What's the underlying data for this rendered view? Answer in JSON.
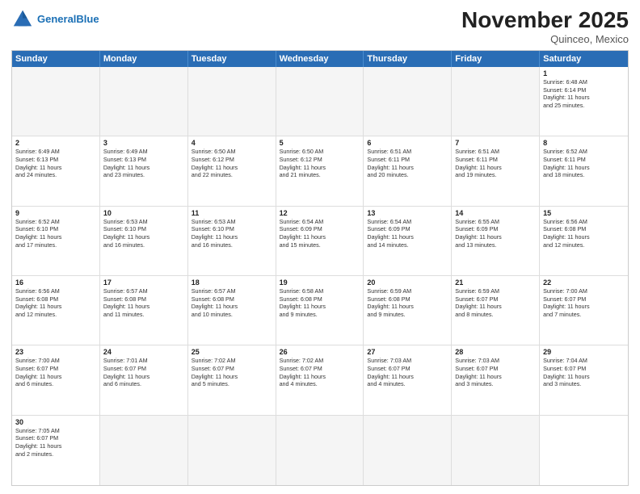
{
  "header": {
    "logo_general": "General",
    "logo_blue": "Blue",
    "month_title": "November 2025",
    "location": "Quinceo, Mexico"
  },
  "days": [
    "Sunday",
    "Monday",
    "Tuesday",
    "Wednesday",
    "Thursday",
    "Friday",
    "Saturday"
  ],
  "cells": [
    {
      "day": "",
      "info": ""
    },
    {
      "day": "",
      "info": ""
    },
    {
      "day": "",
      "info": ""
    },
    {
      "day": "",
      "info": ""
    },
    {
      "day": "",
      "info": ""
    },
    {
      "day": "",
      "info": ""
    },
    {
      "day": "1",
      "info": "Sunrise: 6:48 AM\nSunset: 6:14 PM\nDaylight: 11 hours\nand 25 minutes."
    },
    {
      "day": "2",
      "info": "Sunrise: 6:49 AM\nSunset: 6:13 PM\nDaylight: 11 hours\nand 24 minutes."
    },
    {
      "day": "3",
      "info": "Sunrise: 6:49 AM\nSunset: 6:13 PM\nDaylight: 11 hours\nand 23 minutes."
    },
    {
      "day": "4",
      "info": "Sunrise: 6:50 AM\nSunset: 6:12 PM\nDaylight: 11 hours\nand 22 minutes."
    },
    {
      "day": "5",
      "info": "Sunrise: 6:50 AM\nSunset: 6:12 PM\nDaylight: 11 hours\nand 21 minutes."
    },
    {
      "day": "6",
      "info": "Sunrise: 6:51 AM\nSunset: 6:11 PM\nDaylight: 11 hours\nand 20 minutes."
    },
    {
      "day": "7",
      "info": "Sunrise: 6:51 AM\nSunset: 6:11 PM\nDaylight: 11 hours\nand 19 minutes."
    },
    {
      "day": "8",
      "info": "Sunrise: 6:52 AM\nSunset: 6:11 PM\nDaylight: 11 hours\nand 18 minutes."
    },
    {
      "day": "9",
      "info": "Sunrise: 6:52 AM\nSunset: 6:10 PM\nDaylight: 11 hours\nand 17 minutes."
    },
    {
      "day": "10",
      "info": "Sunrise: 6:53 AM\nSunset: 6:10 PM\nDaylight: 11 hours\nand 16 minutes."
    },
    {
      "day": "11",
      "info": "Sunrise: 6:53 AM\nSunset: 6:10 PM\nDaylight: 11 hours\nand 16 minutes."
    },
    {
      "day": "12",
      "info": "Sunrise: 6:54 AM\nSunset: 6:09 PM\nDaylight: 11 hours\nand 15 minutes."
    },
    {
      "day": "13",
      "info": "Sunrise: 6:54 AM\nSunset: 6:09 PM\nDaylight: 11 hours\nand 14 minutes."
    },
    {
      "day": "14",
      "info": "Sunrise: 6:55 AM\nSunset: 6:09 PM\nDaylight: 11 hours\nand 13 minutes."
    },
    {
      "day": "15",
      "info": "Sunrise: 6:56 AM\nSunset: 6:08 PM\nDaylight: 11 hours\nand 12 minutes."
    },
    {
      "day": "16",
      "info": "Sunrise: 6:56 AM\nSunset: 6:08 PM\nDaylight: 11 hours\nand 12 minutes."
    },
    {
      "day": "17",
      "info": "Sunrise: 6:57 AM\nSunset: 6:08 PM\nDaylight: 11 hours\nand 11 minutes."
    },
    {
      "day": "18",
      "info": "Sunrise: 6:57 AM\nSunset: 6:08 PM\nDaylight: 11 hours\nand 10 minutes."
    },
    {
      "day": "19",
      "info": "Sunrise: 6:58 AM\nSunset: 6:08 PM\nDaylight: 11 hours\nand 9 minutes."
    },
    {
      "day": "20",
      "info": "Sunrise: 6:59 AM\nSunset: 6:08 PM\nDaylight: 11 hours\nand 9 minutes."
    },
    {
      "day": "21",
      "info": "Sunrise: 6:59 AM\nSunset: 6:07 PM\nDaylight: 11 hours\nand 8 minutes."
    },
    {
      "day": "22",
      "info": "Sunrise: 7:00 AM\nSunset: 6:07 PM\nDaylight: 11 hours\nand 7 minutes."
    },
    {
      "day": "23",
      "info": "Sunrise: 7:00 AM\nSunset: 6:07 PM\nDaylight: 11 hours\nand 6 minutes."
    },
    {
      "day": "24",
      "info": "Sunrise: 7:01 AM\nSunset: 6:07 PM\nDaylight: 11 hours\nand 6 minutes."
    },
    {
      "day": "25",
      "info": "Sunrise: 7:02 AM\nSunset: 6:07 PM\nDaylight: 11 hours\nand 5 minutes."
    },
    {
      "day": "26",
      "info": "Sunrise: 7:02 AM\nSunset: 6:07 PM\nDaylight: 11 hours\nand 4 minutes."
    },
    {
      "day": "27",
      "info": "Sunrise: 7:03 AM\nSunset: 6:07 PM\nDaylight: 11 hours\nand 4 minutes."
    },
    {
      "day": "28",
      "info": "Sunrise: 7:03 AM\nSunset: 6:07 PM\nDaylight: 11 hours\nand 3 minutes."
    },
    {
      "day": "29",
      "info": "Sunrise: 7:04 AM\nSunset: 6:07 PM\nDaylight: 11 hours\nand 3 minutes."
    },
    {
      "day": "30",
      "info": "Sunrise: 7:05 AM\nSunset: 6:07 PM\nDaylight: 11 hours\nand 2 minutes."
    },
    {
      "day": "",
      "info": ""
    },
    {
      "day": "",
      "info": ""
    },
    {
      "day": "",
      "info": ""
    },
    {
      "day": "",
      "info": ""
    },
    {
      "day": "",
      "info": ""
    }
  ]
}
